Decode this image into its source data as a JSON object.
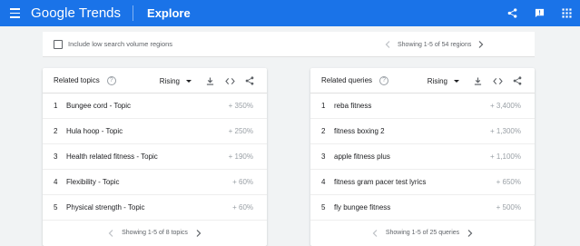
{
  "header": {
    "logo_google": "Google",
    "logo_trends": "Trends",
    "title": "Explore"
  },
  "filters": {
    "low_volume_label": "Include low search volume regions",
    "regions_pager": "Showing 1-5 of 54 regions"
  },
  "topics": {
    "title": "Related topics",
    "metric": "Rising",
    "rows": [
      {
        "rank": "1",
        "label": "Bungee cord - Topic",
        "value": "+ 350%"
      },
      {
        "rank": "2",
        "label": "Hula hoop - Topic",
        "value": "+ 250%"
      },
      {
        "rank": "3",
        "label": "Health related fitness - Topic",
        "value": "+ 190%"
      },
      {
        "rank": "4",
        "label": "Flexibility - Topic",
        "value": "+ 60%"
      },
      {
        "rank": "5",
        "label": "Physical strength - Topic",
        "value": "+ 60%"
      }
    ],
    "pager": "Showing 1-5 of 8 topics"
  },
  "queries": {
    "title": "Related queries",
    "metric": "Rising",
    "rows": [
      {
        "rank": "1",
        "label": "reba fitness",
        "value": "+ 3,400%"
      },
      {
        "rank": "2",
        "label": "fitness boxing 2",
        "value": "+ 1,300%"
      },
      {
        "rank": "3",
        "label": "apple fitness plus",
        "value": "+ 1,100%"
      },
      {
        "rank": "4",
        "label": "fitness gram pacer test lyrics",
        "value": "+ 650%"
      },
      {
        "rank": "5",
        "label": "fly bungee fitness",
        "value": "+ 500%"
      }
    ],
    "pager": "Showing 1-5 of 25 queries"
  },
  "colors": {
    "brand": "#1a73e8",
    "muted_text": "#9aa0a6"
  }
}
